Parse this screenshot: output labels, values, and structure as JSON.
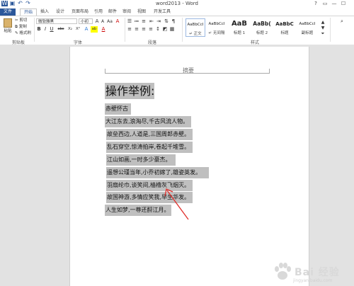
{
  "window": {
    "title": "word2013 - Word",
    "help": "?",
    "ribbon_display": "▭",
    "minimize": "—",
    "maximize": "☐"
  },
  "qat": {
    "save_icon": "floppy-disk-icon",
    "undo_icon": "undo-icon",
    "redo_icon": "redo-icon"
  },
  "tabs": [
    "文件",
    "开始",
    "插入",
    "设计",
    "页面布局",
    "引用",
    "邮件",
    "审阅",
    "视图",
    "开发工具"
  ],
  "ribbon": {
    "clipboard": {
      "paste": "粘贴",
      "cut": "剪切",
      "copy": "复制",
      "format_painter": "格式刷",
      "label": "剪贴板"
    },
    "font": {
      "font_name": "微软雅黑",
      "font_size": "小初",
      "grow": "A",
      "shrink": "A",
      "change_case": "Aa",
      "clear": "A",
      "bold": "B",
      "italic": "I",
      "underline": "U",
      "strike": "abc",
      "subscript": "X₂",
      "superscript": "X²",
      "effects": "A",
      "highlight": "ab",
      "color": "A",
      "label": "字体"
    },
    "paragraph": {
      "label": "段落"
    },
    "styles": {
      "items": [
        {
          "sample": "AaBbCcI",
          "name": "↵ 正文"
        },
        {
          "sample": "AaBbCcI",
          "name": "↵ 无间隔"
        },
        {
          "sample": "AaB",
          "name": "标题 1"
        },
        {
          "sample": "AaBb(",
          "name": "标题 2"
        },
        {
          "sample": "AaBbC",
          "name": "标题"
        },
        {
          "sample": "AaBbCcI",
          "name": "副标题"
        }
      ],
      "label": "样式"
    }
  },
  "document": {
    "header_text": "摘要",
    "heading": "操作举例:",
    "lines": [
      "赤壁怀古",
      "大江东去,浪淘尽,千古风流人物。",
      "故垒西边,人道是,三国周郎赤壁。",
      "乱石穿空,惊涛拍岸,卷起千堆雪。",
      "江山如画,一时多少豪杰。",
      "遥想公瑾当年,小乔初嫁了,雄姿英发。",
      "羽扇纶巾,谈笑间,樯橹灰飞烟灭。",
      "故国神游,多情应笑我,早生华发。",
      "人生如梦,一尊还酹江月。"
    ]
  },
  "annotation": {
    "arrow_color": "#e0302c"
  },
  "watermark": {
    "text": "Bai 经验",
    "sub": "jingyan.baidu.com"
  },
  "colors": {
    "accent": "#2b579a",
    "selection": "#bfbfbf"
  }
}
